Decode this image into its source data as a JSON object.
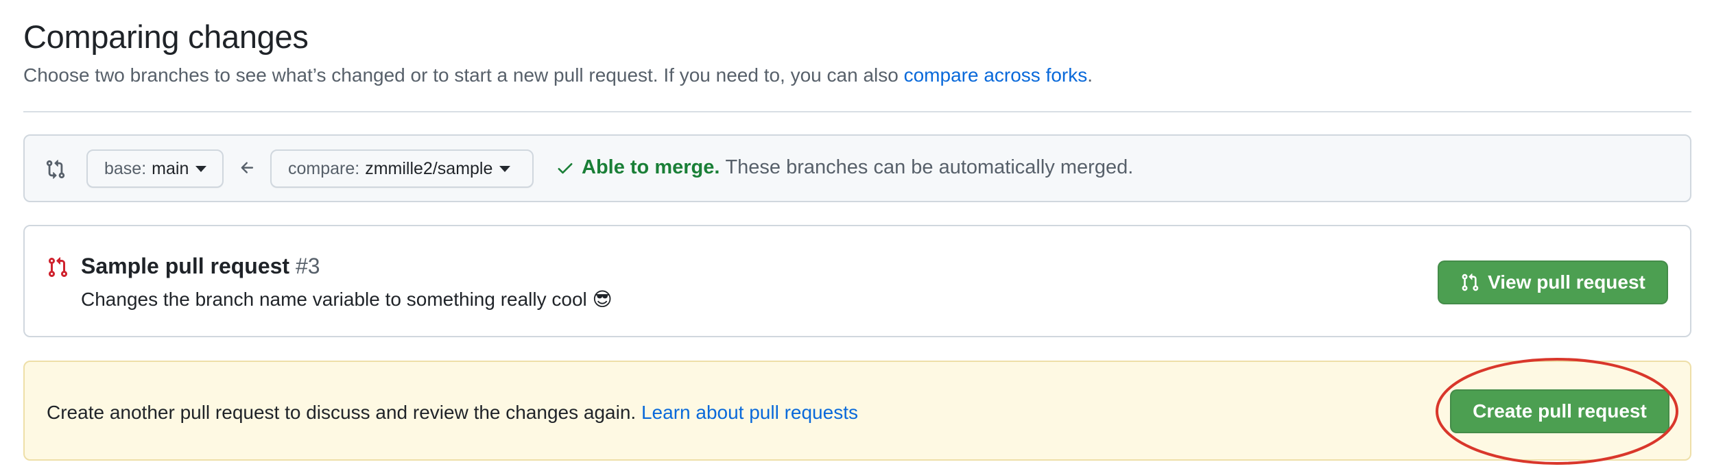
{
  "header": {
    "title": "Comparing changes",
    "subtitle": "Choose two branches to see what’s changed or to start a new pull request. If you need to, you can also ",
    "subtitle_link": "compare across forks",
    "subtitle_end": "."
  },
  "range": {
    "base_prefix": "base:",
    "base_value": "main",
    "compare_prefix": "compare:",
    "compare_value": "zmmille2/sample",
    "merge_status": "Able to merge.",
    "merge_desc": "These branches can be automatically merged."
  },
  "existing_pr": {
    "title": "Sample pull request",
    "number": "#3",
    "description": "Changes the branch name variable to something really cool 😎",
    "view_button": "View pull request"
  },
  "create": {
    "text": "Create another pull request to discuss and review the changes again. ",
    "link": "Learn about pull requests",
    "button": "Create pull request"
  },
  "colors": {
    "green_button": "#4c9f51",
    "link": "#0969da",
    "merge_ok": "#1a7f37",
    "pr_icon": "#cf222e",
    "highlight_ellipse": "#d9372b",
    "create_bg": "#fef9e3"
  },
  "icons": {
    "compare": "git-compare-icon",
    "arrow": "arrow-left-icon",
    "check": "check-icon",
    "pr": "git-pull-request-icon"
  }
}
